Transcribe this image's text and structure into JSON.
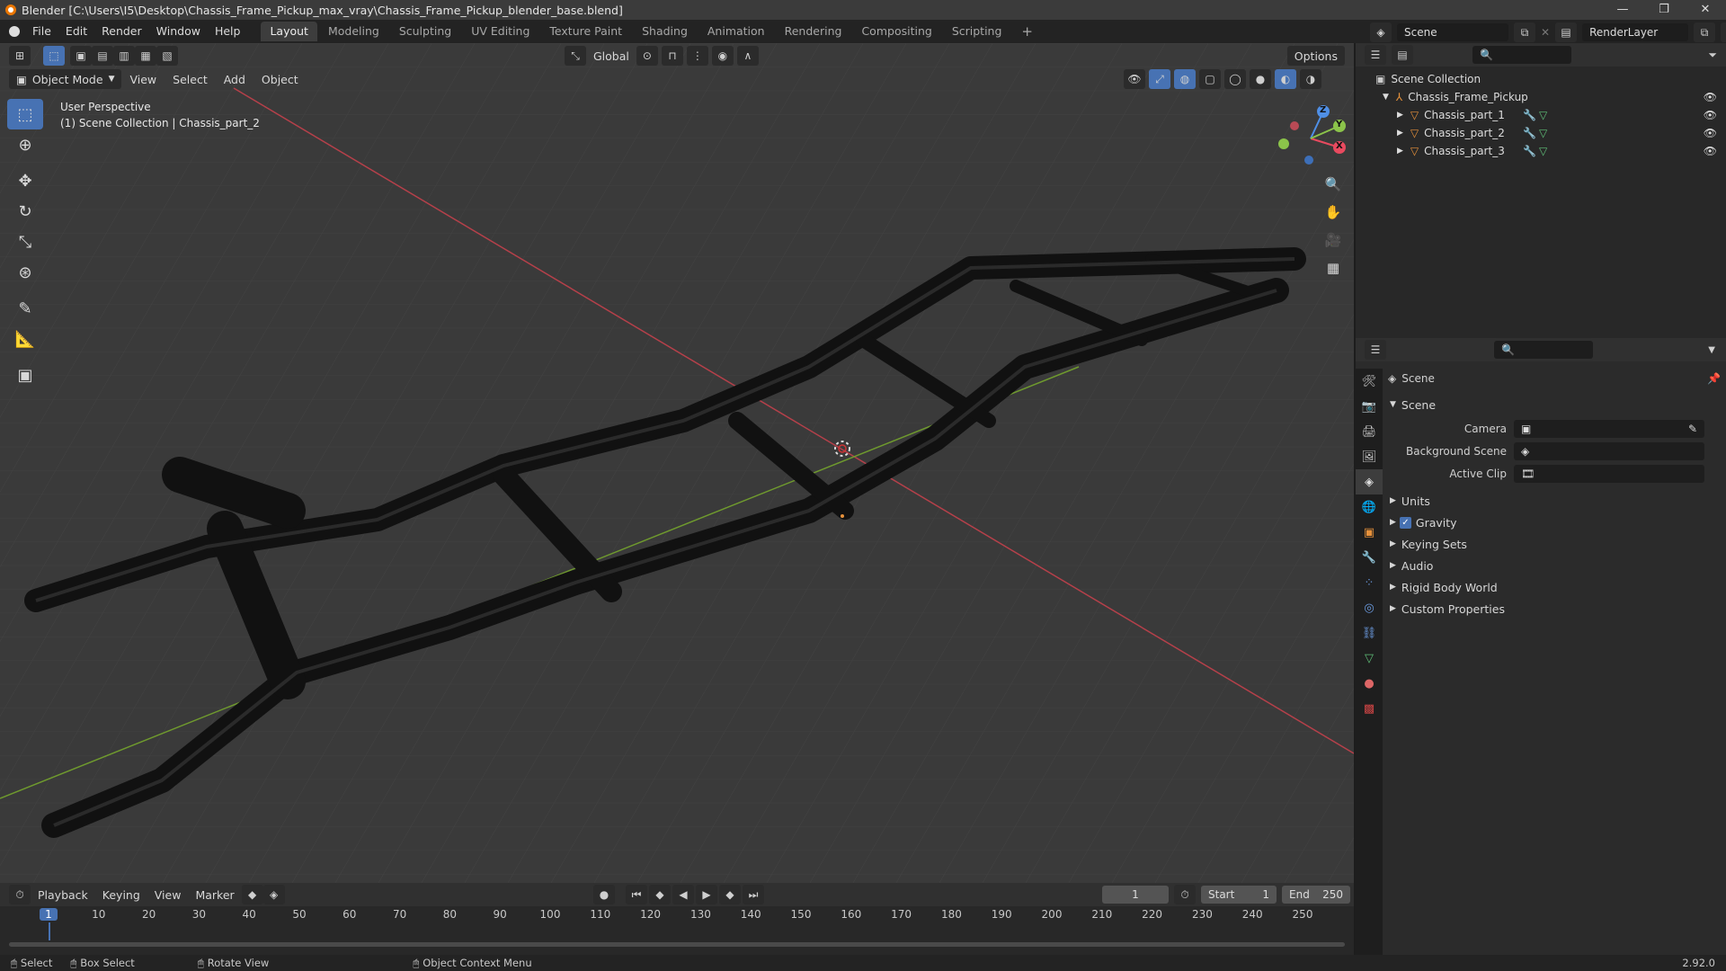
{
  "title_bar": {
    "title": "Blender [C:\\Users\\I5\\Desktop\\Chassis_Frame_Pickup_max_vray\\Chassis_Frame_Pickup_blender_base.blend]",
    "minimize": "—",
    "maximize": "❐",
    "close": "✕"
  },
  "menu": {
    "items": [
      "File",
      "Edit",
      "Render",
      "Window",
      "Help"
    ],
    "workspaces": [
      "Layout",
      "Modeling",
      "Sculpting",
      "UV Editing",
      "Texture Paint",
      "Shading",
      "Animation",
      "Rendering",
      "Compositing",
      "Scripting"
    ],
    "active_workspace": "Layout",
    "add_workspace": "+",
    "scene_field": "Scene",
    "view_layer_field": "RenderLayer"
  },
  "viewport": {
    "mode": "Object Mode",
    "menus": [
      "View",
      "Select",
      "Add",
      "Object"
    ],
    "orientation": "Global",
    "options": "Options",
    "overlay_title": "User Perspective",
    "overlay_subtitle": "(1) Scene Collection | Chassis_part_2",
    "gizmo_axes": [
      "X",
      "Y",
      "Z"
    ]
  },
  "outliner": {
    "root": "Scene Collection",
    "collection": "Chassis_Frame_Pickup",
    "objects": [
      "Chassis_part_1",
      "Chassis_part_2",
      "Chassis_part_3"
    ]
  },
  "properties": {
    "header": "Scene",
    "panel": "Scene",
    "fields": [
      {
        "label": "Camera",
        "value": ""
      },
      {
        "label": "Background Scene",
        "value": ""
      },
      {
        "label": "Active Clip",
        "value": ""
      }
    ],
    "subpanels": [
      "Units",
      "Gravity",
      "Keying Sets",
      "Audio",
      "Rigid Body World",
      "Custom Properties"
    ],
    "gravity_checked": true
  },
  "timeline": {
    "menus": [
      "Playback",
      "Keying",
      "View",
      "Marker"
    ],
    "current_frame": "1",
    "start_label": "Start",
    "start_value": "1",
    "end_label": "End",
    "end_value": "250",
    "ticks": [
      "1",
      "10",
      "20",
      "30",
      "40",
      "50",
      "60",
      "70",
      "80",
      "90",
      "100",
      "110",
      "120",
      "130",
      "140",
      "150",
      "160",
      "170",
      "180",
      "190",
      "200",
      "210",
      "220",
      "230",
      "240",
      "250"
    ]
  },
  "status_bar": {
    "items": [
      "Select",
      "Box Select",
      "Rotate View",
      "Object Context Menu"
    ],
    "version": "2.92.0"
  },
  "colors": {
    "accent": "#4772b3",
    "x_axis": "#e84a5f",
    "y_axis": "#8bc34a",
    "z_axis": "#4f8fe6",
    "object_orange": "#e6913b"
  }
}
